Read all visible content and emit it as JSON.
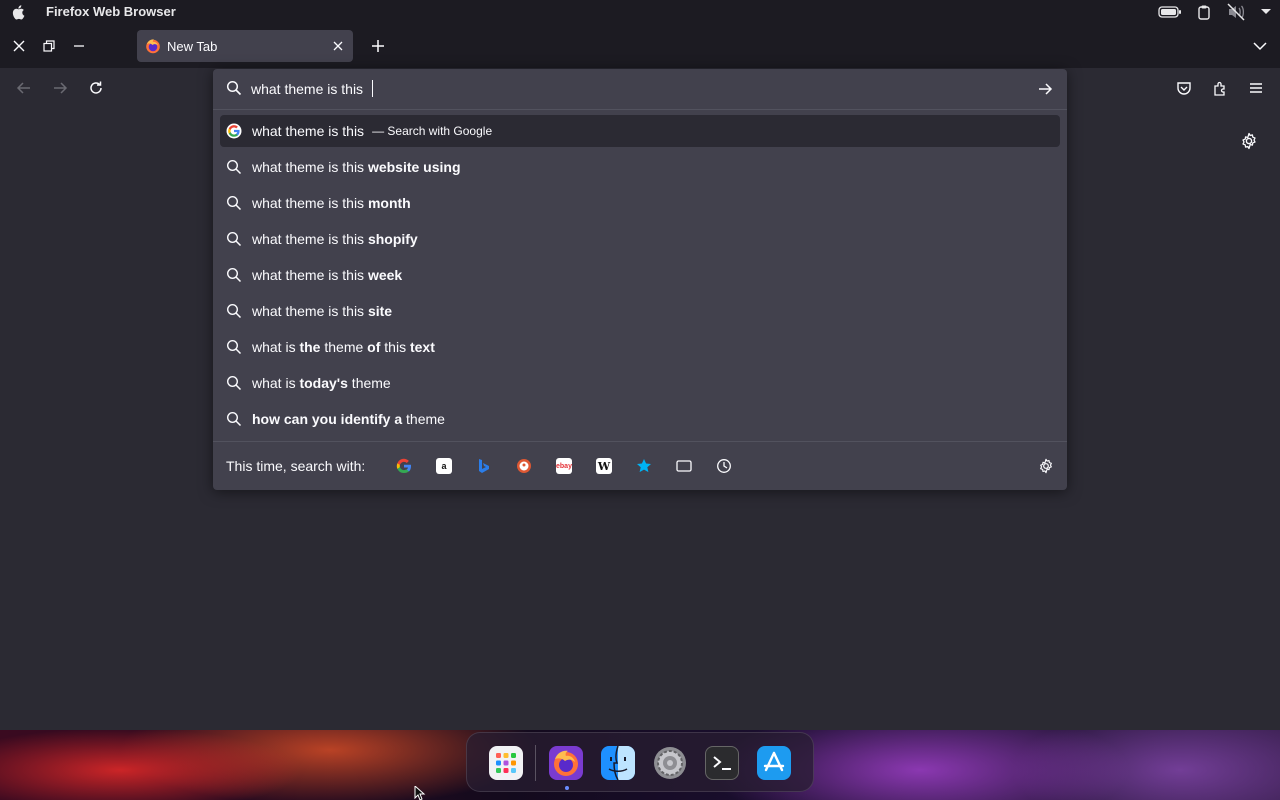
{
  "menubar": {
    "app_name": "Firefox Web Browser"
  },
  "tabs": [
    {
      "title": "New Tab"
    }
  ],
  "urlbar": {
    "value": "what theme is this",
    "results": [
      {
        "icon": "google-icon",
        "text_parts": [
          {
            "text": "what theme is this",
            "bold": false
          }
        ],
        "action": "— Search with Google",
        "selected": true
      },
      {
        "icon": "search-icon",
        "text_parts": [
          {
            "text": "what theme is this ",
            "bold": false
          },
          {
            "text": "website using",
            "bold": true
          }
        ]
      },
      {
        "icon": "search-icon",
        "text_parts": [
          {
            "text": "what theme is this ",
            "bold": false
          },
          {
            "text": "month",
            "bold": true
          }
        ]
      },
      {
        "icon": "search-icon",
        "text_parts": [
          {
            "text": "what theme is this ",
            "bold": false
          },
          {
            "text": "shopify",
            "bold": true
          }
        ]
      },
      {
        "icon": "search-icon",
        "text_parts": [
          {
            "text": "what theme is this ",
            "bold": false
          },
          {
            "text": "week",
            "bold": true
          }
        ]
      },
      {
        "icon": "search-icon",
        "text_parts": [
          {
            "text": "what theme is this ",
            "bold": false
          },
          {
            "text": "site",
            "bold": true
          }
        ]
      },
      {
        "icon": "search-icon",
        "text_parts": [
          {
            "text": "what is ",
            "bold": false
          },
          {
            "text": "the",
            "bold": true
          },
          {
            "text": " theme ",
            "bold": false
          },
          {
            "text": "of",
            "bold": true
          },
          {
            "text": " this ",
            "bold": false
          },
          {
            "text": "text",
            "bold": true
          }
        ]
      },
      {
        "icon": "search-icon",
        "text_parts": [
          {
            "text": "what is ",
            "bold": false
          },
          {
            "text": "today's",
            "bold": true
          },
          {
            "text": " theme",
            "bold": false
          }
        ]
      },
      {
        "icon": "search-icon",
        "text_parts": [
          {
            "text": "how can you identify a",
            "bold": true
          },
          {
            "text": " theme",
            "bold": false
          }
        ]
      }
    ],
    "oneoff_label": "This time, search with:",
    "oneoff_engines": [
      "google-icon",
      "amazon-icon",
      "bing-icon",
      "duckduckgo-icon",
      "ebay-icon",
      "wikipedia-icon",
      "bookmarks-icon",
      "tabs-icon",
      "history-icon"
    ]
  },
  "dock": {
    "apps": [
      "launchpad-icon",
      "firefox-icon",
      "finder-icon",
      "system-settings-icon",
      "terminal-icon",
      "app-store-icon"
    ]
  },
  "colors": {
    "toolbar_bg": "#2b2a33",
    "popup_bg": "#42414d",
    "text": "#fbfbfe"
  }
}
